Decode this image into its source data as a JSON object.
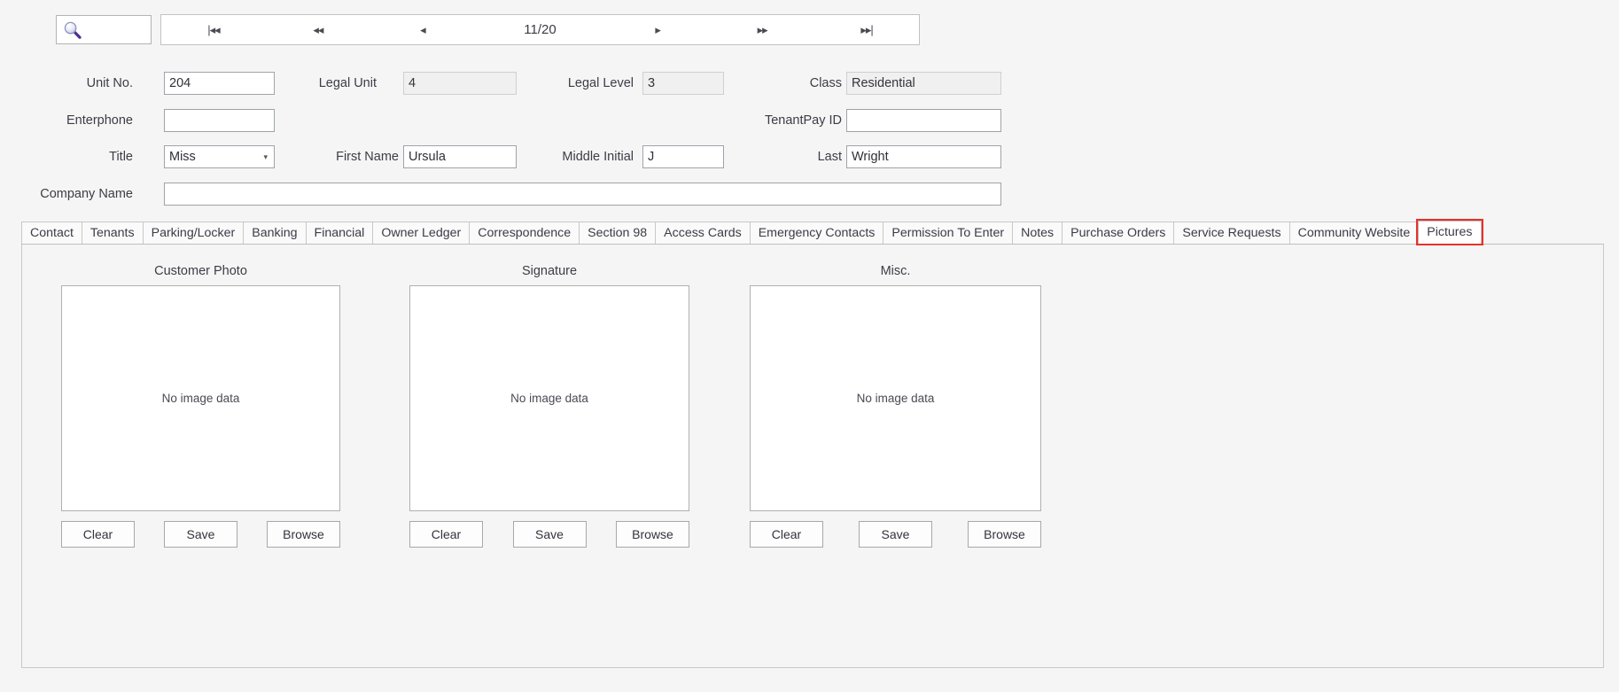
{
  "toolbar": {
    "search_icon": "magnifier-icon",
    "search_value": "",
    "nav": {
      "first_label": "|◂◂",
      "prev_page_label": "◂◂",
      "prev_label": "◂",
      "position": "11/20",
      "next_label": "▸",
      "next_page_label": "▸▸",
      "last_label": "▸▸|"
    }
  },
  "form": {
    "unit_no": {
      "label": "Unit No.",
      "value": "204"
    },
    "legal_unit": {
      "label": "Legal Unit",
      "value": "4"
    },
    "legal_level": {
      "label": "Legal Level",
      "value": "3"
    },
    "class": {
      "label": "Class",
      "value": "Residential"
    },
    "enterphone": {
      "label": "Enterphone",
      "value": ""
    },
    "tenantpay_id": {
      "label": "TenantPay ID",
      "value": ""
    },
    "title": {
      "label": "Title",
      "value": "Miss",
      "arrow": "▾"
    },
    "first_name": {
      "label": "First Name",
      "value": "Ursula"
    },
    "middle_initial": {
      "label": "Middle Initial",
      "value": "J"
    },
    "last": {
      "label": "Last",
      "value": "Wright"
    },
    "company_name": {
      "label": "Company Name",
      "value": ""
    }
  },
  "tabs": [
    {
      "label": "Contact",
      "active": false
    },
    {
      "label": "Tenants",
      "active": false
    },
    {
      "label": "Parking/Locker",
      "active": false
    },
    {
      "label": "Banking",
      "active": false
    },
    {
      "label": "Financial",
      "active": false
    },
    {
      "label": "Owner Ledger",
      "active": false
    },
    {
      "label": "Correspondence",
      "active": false
    },
    {
      "label": "Section 98",
      "active": false
    },
    {
      "label": "Access Cards",
      "active": false
    },
    {
      "label": "Emergency Contacts",
      "active": false
    },
    {
      "label": "Permission To Enter",
      "active": false
    },
    {
      "label": "Notes",
      "active": false
    },
    {
      "label": "Purchase Orders",
      "active": false
    },
    {
      "label": "Service Requests",
      "active": false
    },
    {
      "label": "Community Website",
      "active": false
    },
    {
      "label": "Pictures",
      "active": true
    }
  ],
  "pictures": {
    "placeholder": "No image data",
    "panels": [
      {
        "title": "Customer Photo",
        "placeholder": "No image data",
        "clear_label": "Clear",
        "save_label": "Save",
        "browse_label": "Browse"
      },
      {
        "title": "Signature",
        "placeholder": "No image data",
        "clear_label": "Clear",
        "save_label": "Save",
        "browse_label": "Browse"
      },
      {
        "title": "Misc.",
        "placeholder": "No image data",
        "clear_label": "Clear",
        "save_label": "Save",
        "browse_label": "Browse"
      }
    ]
  },
  "colors": {
    "page_bg": "#f5f5f5",
    "field_border": "#9fa3a8",
    "readonly_bg": "#f0f0f0",
    "highlight": "#e8312b",
    "text": "#3c3c46"
  }
}
